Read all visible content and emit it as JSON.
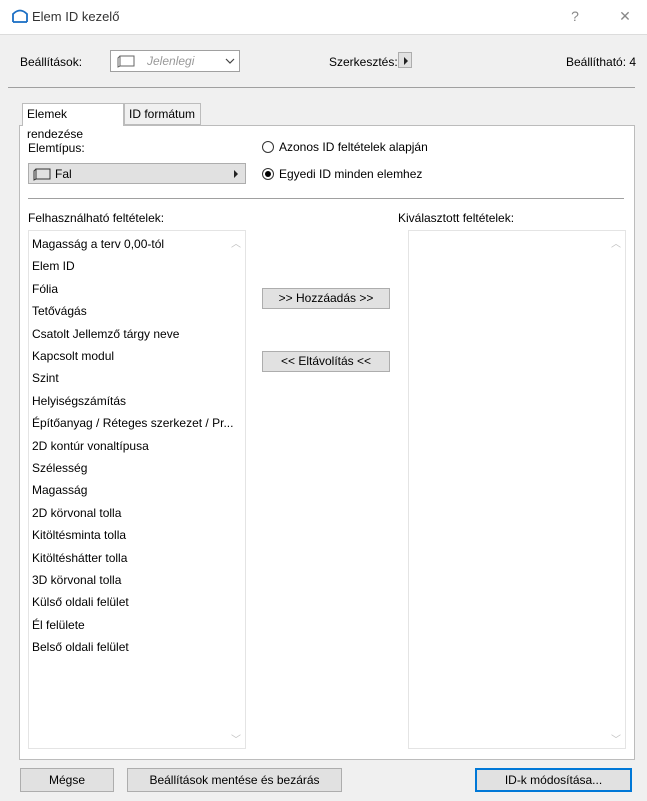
{
  "window": {
    "title": "Elem ID kezelő",
    "help": "?",
    "close": "✕"
  },
  "header": {
    "settings_label": "Beállítások:",
    "settings_value": "Jelenlegi",
    "edit_label": "Szerkesztés:",
    "settable_label": "Beállítható: 4"
  },
  "tabs": [
    {
      "label": "Elemek rendezése",
      "active": true
    },
    {
      "label": "ID formátum",
      "active": false
    }
  ],
  "element_type": {
    "label": "Elemtípus:",
    "value": "Fal"
  },
  "radios": [
    {
      "label": "Azonos ID feltételek alapján",
      "selected": false
    },
    {
      "label": "Egyedi ID minden elemhez",
      "selected": true
    }
  ],
  "available": {
    "label": "Felhasználható feltételek:",
    "items": [
      "Magasság a terv 0,00-tól",
      "Elem ID",
      "Fólia",
      "Tetővágás",
      "Csatolt Jellemző tárgy neve",
      "Kapcsolt modul",
      "Szint",
      "Helyiségszámítás",
      "Építőanyag / Réteges szerkezet / Pr...",
      "2D kontúr vonaltípusa",
      "Szélesség",
      "Magasság",
      "2D körvonal tolla",
      "Kitöltésminta tolla",
      "Kitöltéshátter tolla",
      "3D körvonal tolla",
      "Külső oldali felület",
      "Él felülete",
      "Belső oldali felület"
    ]
  },
  "selected": {
    "label": "Kiválasztott feltételek:",
    "items": []
  },
  "buttons": {
    "add": ">> Hozzáadás >>",
    "remove": "<< Eltávolítás <<",
    "cancel": "Mégse",
    "save_close": "Beállítások mentése és bezárás",
    "modify_ids": "ID-k módosítása..."
  },
  "colors": {
    "accent": "#0078d7",
    "dialog_bg": "#f0f0f0"
  }
}
